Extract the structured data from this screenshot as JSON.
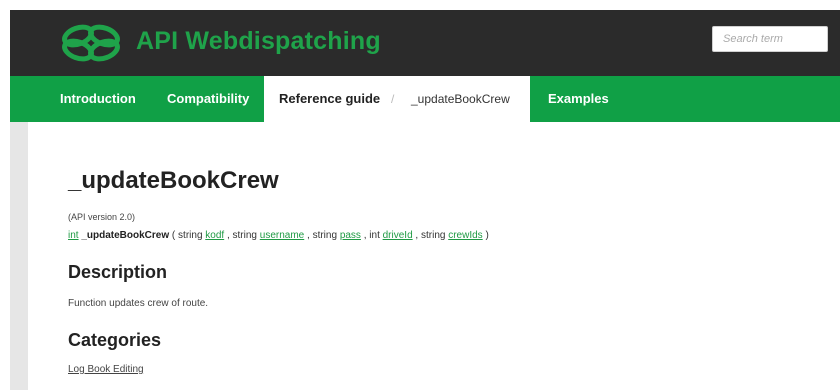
{
  "header": {
    "brand": "API Webdispatching",
    "search_placeholder": "Search term",
    "colors": {
      "header_bg": "#2b2b2b",
      "brand_green": "#1fa34a",
      "nav_green": "#10a046"
    }
  },
  "nav": {
    "items": [
      "Introduction",
      "Compatibility",
      "Examples"
    ],
    "breadcrumb": [
      "Reference guide",
      "_updateBookCrew"
    ],
    "separator": "/"
  },
  "page": {
    "title": "_updateBookCrew",
    "api_version": "(API version 2.0)",
    "signature": {
      "return_type": "int",
      "function": "_updateBookCrew",
      "open": "(",
      "close": ")",
      "comma": ",",
      "params": [
        {
          "type": "string",
          "name": "kodf"
        },
        {
          "type": "string",
          "name": "username"
        },
        {
          "type": "string",
          "name": "pass"
        },
        {
          "type": "int",
          "name": "driveId"
        },
        {
          "type": "string",
          "name": "crewIds"
        }
      ]
    },
    "description_heading": "Description",
    "description_text": "Function updates crew of route.",
    "categories_heading": "Categories",
    "categories": [
      "Log Book Editing"
    ]
  }
}
